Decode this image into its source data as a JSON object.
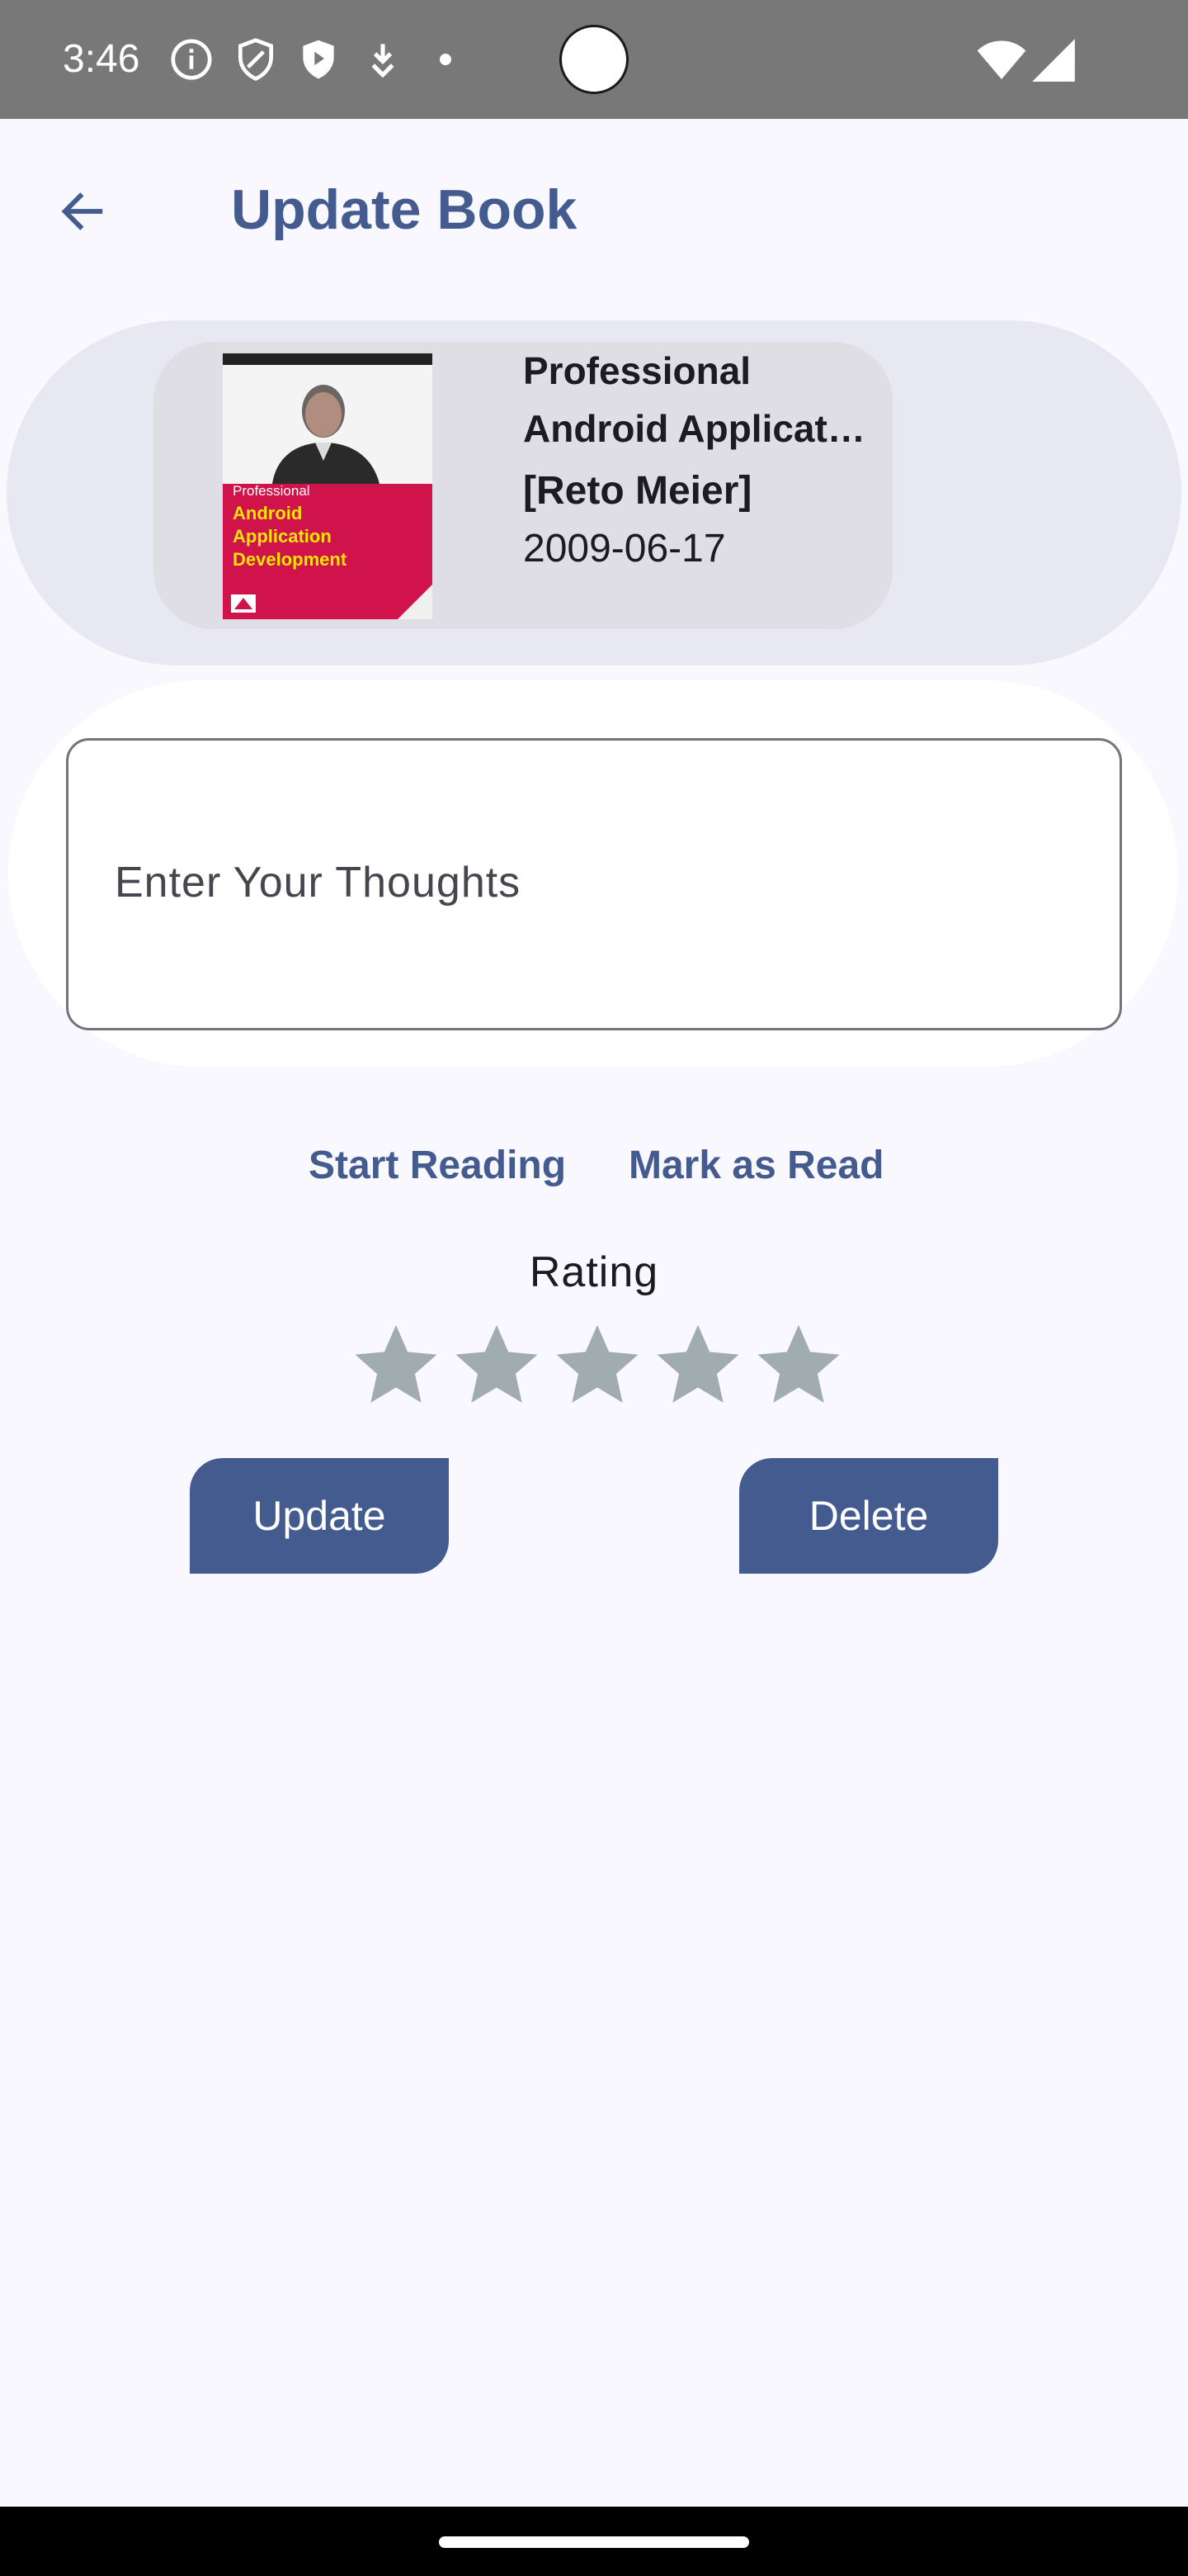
{
  "status_bar": {
    "time": "3:46",
    "icons": [
      "info-icon",
      "shield-icon",
      "play-protect-icon",
      "download-icon",
      "dot-icon",
      "wifi-icon",
      "signal-icon"
    ]
  },
  "app_bar": {
    "title": "Update Book",
    "back_icon": "arrow-back-icon"
  },
  "book": {
    "title_line1": "Professional",
    "title_line2": "Android Applicat…",
    "author": "[Reto Meier]",
    "published_date": "2009-06-17",
    "cover": {
      "series": "Professional",
      "title_lines": [
        "Android",
        "Application",
        "Development"
      ],
      "colors": {
        "band": "#d0134a",
        "title": "#f3e600"
      }
    }
  },
  "thoughts": {
    "placeholder": "Enter Your Thoughts",
    "value": ""
  },
  "reading_actions": {
    "start_label": "Start Reading",
    "mark_read_label": "Mark as Read"
  },
  "rating": {
    "label": "Rating",
    "max_stars": 5,
    "value": 0
  },
  "actions": {
    "update_label": "Update",
    "delete_label": "Delete"
  },
  "colors": {
    "primary": "#435b8f",
    "background": "#f9f8fe",
    "star_inactive": "#a1acae",
    "status_bar": "#787878"
  }
}
